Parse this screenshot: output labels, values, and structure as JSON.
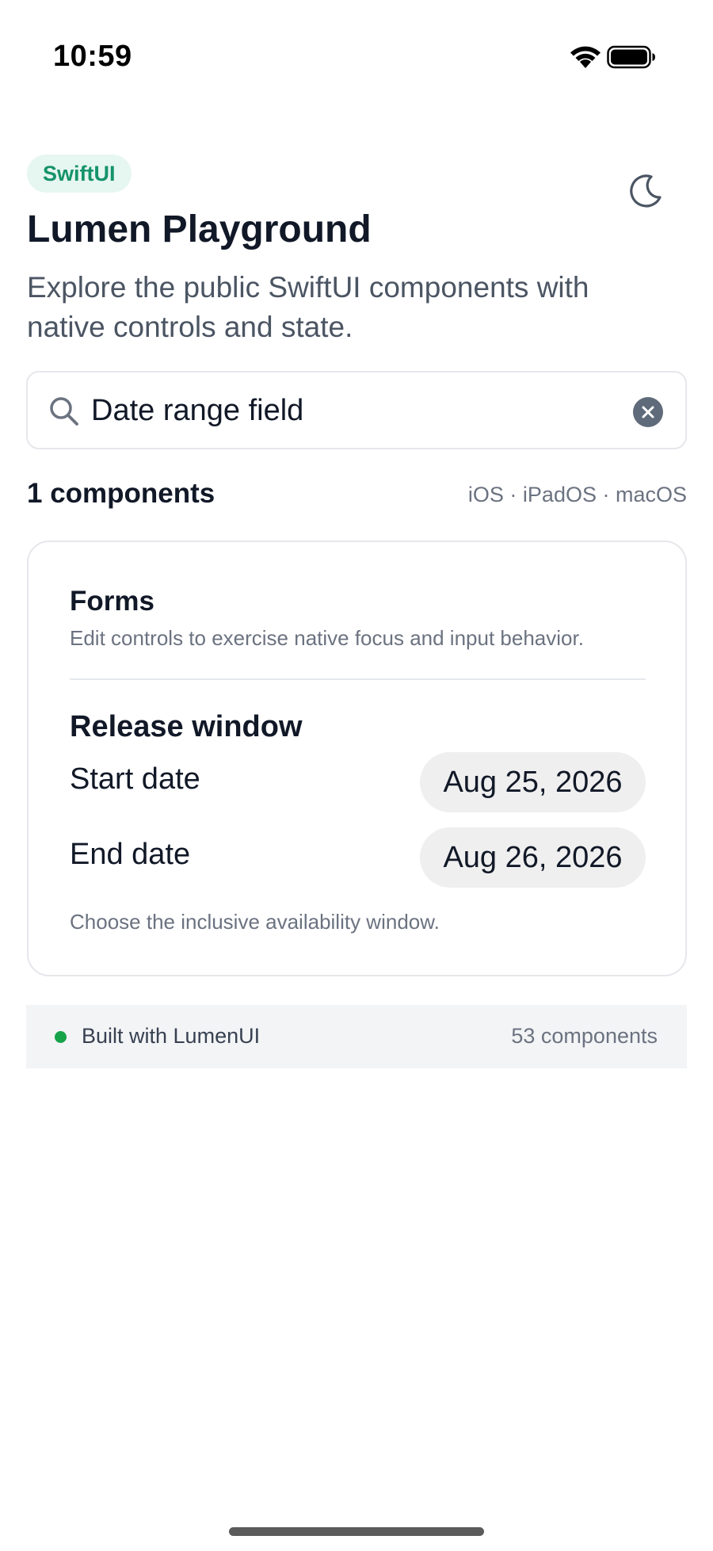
{
  "status_bar": {
    "time": "10:59"
  },
  "header": {
    "badge": "SwiftUI",
    "title": "Lumen Playground",
    "subtitle": "Explore the public SwiftUI components with native controls and state.",
    "theme_icon": "moon-icon"
  },
  "search": {
    "value": "Date range field",
    "placeholder": "Search components"
  },
  "results": {
    "count_label": "1 components",
    "platforms": "iOS · iPadOS · macOS"
  },
  "card": {
    "title": "Forms",
    "description": "Edit controls to exercise native focus and input behavior.",
    "section_title": "Release window",
    "rows": [
      {
        "label": "Start date",
        "value": "Aug 25, 2026"
      },
      {
        "label": "End date",
        "value": "Aug 26, 2026"
      }
    ],
    "hint": "Choose the inclusive availability window."
  },
  "footer": {
    "left": "Built with LumenUI",
    "right": "53 components"
  },
  "colors": {
    "accent": "#15936b",
    "badge_bg": "#e6f6f0",
    "status_green": "#16a34a",
    "text_primary": "#111827",
    "text_secondary": "#6b7280"
  }
}
